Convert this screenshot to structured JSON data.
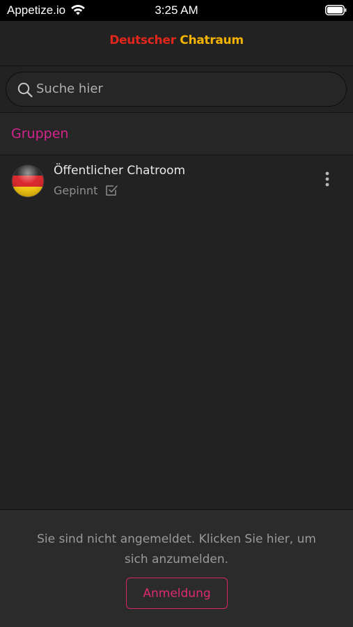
{
  "status_bar": {
    "carrier": "Appetize.io",
    "time": "3:25 AM",
    "wifi_icon": "wifi-icon",
    "battery_icon": "battery-icon"
  },
  "header": {
    "title_part_1": "Deutscher",
    "title_part_2": "Chatraum",
    "colors": {
      "title_part_1": "#e2261c",
      "title_part_2": "#f5b400"
    }
  },
  "search": {
    "placeholder": "Suche hier",
    "value": "",
    "icon": "search-icon"
  },
  "groups_section": {
    "title": "Gruppen",
    "accent_color": "#d6238d",
    "items": [
      {
        "name": "Öffentlicher Chatroom",
        "status": "Gepinnt",
        "avatar_icon": "germany-flag-icon",
        "status_icon": "checkbox-icon",
        "menu_icon": "more-vertical-icon"
      }
    ]
  },
  "login_banner": {
    "message_line_1": "Sie sind nicht angemeldet. Klicken Sie hier, um",
    "message_line_2": "sich anzumelden.",
    "button_label": "Anmeldung",
    "button_color": "#e0296f"
  }
}
